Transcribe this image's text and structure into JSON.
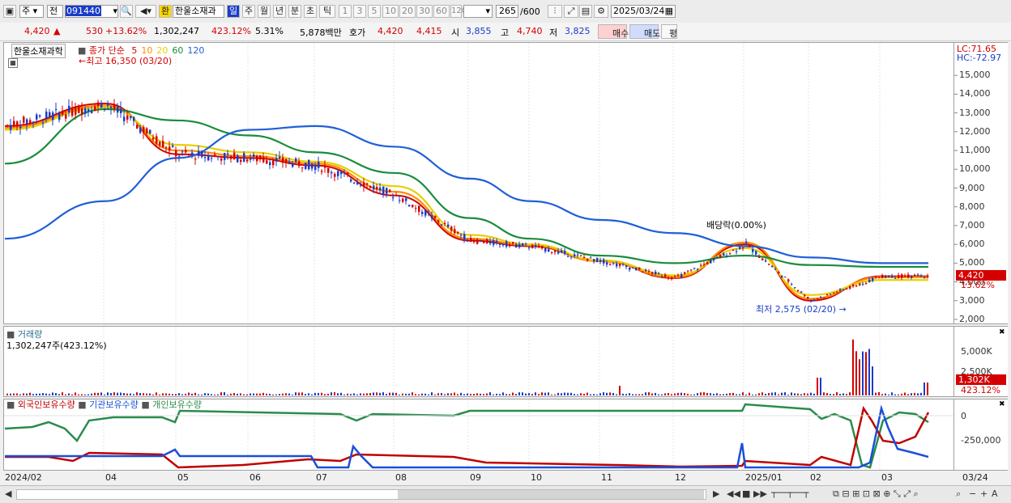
{
  "toolbar": {
    "market": "주",
    "prev": "전",
    "code": "091440",
    "fx": "환",
    "name": "한울소재과",
    "periods": [
      "일",
      "주",
      "월",
      "년",
      "분",
      "초",
      "틱"
    ],
    "nums": [
      "1",
      "3",
      "5",
      "10",
      "20",
      "30",
      "60",
      "120"
    ],
    "count": "265",
    "count_total": "/600",
    "date": "2025/03/24"
  },
  "info": {
    "price": "4,420",
    "arrow": "▲",
    "change": "530",
    "change_pct": "+13.62%",
    "volume": "1,302,247",
    "vol_pct": "423.12%",
    "turnover": "5.31%",
    "amount": "5,878백만",
    "quote_label": "호가",
    "ask": "4,420",
    "bid": "4,415",
    "open_label": "시",
    "open": "3,855",
    "high_label": "고",
    "high": "4,740",
    "low_label": "저",
    "low": "3,825",
    "buy": "매수",
    "sell": "매도",
    "eval": "평"
  },
  "price_panel": {
    "stock_label": "한울소재과학",
    "legend_prefix": "종가 단순",
    "ma": [
      {
        "label": "5",
        "color": "#d40000"
      },
      {
        "label": "10",
        "color": "#ff8c00"
      },
      {
        "label": "20",
        "color": "#e6d000"
      },
      {
        "label": "60",
        "color": "#1a8c3c"
      },
      {
        "label": "120",
        "color": "#1f5fd8"
      }
    ],
    "high_note": "최고 16,350 (03/20)",
    "low_note": "최저 2,575 (02/20)",
    "div_note": "배당락(0.00%)",
    "lc": "LC:71.65",
    "hc": "HC:-72.97",
    "cur_tag": "4,420",
    "pct_tag": "13.62%",
    "y_ticks": [
      "15,000",
      "14,000",
      "13,000",
      "12,000",
      "11,000",
      "10,000",
      "9,000",
      "8,000",
      "7,000",
      "6,000",
      "5,000",
      "4,000",
      "3,000",
      "2,000"
    ]
  },
  "volume_panel": {
    "title": "거래량",
    "value": "1,302,247주(423.12%)",
    "y_ticks": [
      "5,000K",
      "2,500K"
    ],
    "tag1": "1,302K",
    "tag2": "423.12%"
  },
  "holding_panel": {
    "legend": [
      {
        "label": "외국인보유수량",
        "color": "#c00000"
      },
      {
        "label": "기관보유수량",
        "color": "#1a4fd8"
      },
      {
        "label": "개인보유수량",
        "color": "#2a8c4c"
      }
    ],
    "y_ticks": [
      "0",
      "-250,000"
    ]
  },
  "x_axis": [
    "2024/02",
    "04",
    "05",
    "06",
    "07",
    "08",
    "09",
    "10",
    "11",
    "12",
    "2025/01",
    "02",
    "03",
    "03/24"
  ],
  "chart_data": {
    "type": "line",
    "title": "한울소재과학",
    "x": [
      "2024/02",
      "04",
      "05",
      "06",
      "07",
      "08",
      "09",
      "10",
      "11",
      "12",
      "2025/01",
      "02",
      "03"
    ],
    "series": [
      {
        "name": "5",
        "values": [
          12300,
          13500,
          10800,
          10600,
          10200,
          8600,
          6200,
          5900,
          5100,
          4200,
          6000,
          3000,
          4300
        ]
      },
      {
        "name": "10",
        "values": [
          12200,
          13400,
          11000,
          10700,
          10300,
          8800,
          6300,
          5950,
          5100,
          4250,
          6100,
          3100,
          4250
        ]
      },
      {
        "name": "20",
        "values": [
          12100,
          13300,
          11300,
          10900,
          10400,
          9100,
          6500,
          6000,
          5150,
          4350,
          5800,
          3300,
          4100
        ]
      },
      {
        "name": "60",
        "values": [
          10300,
          13200,
          12600,
          11800,
          10900,
          9800,
          7400,
          6300,
          5400,
          5000,
          5400,
          4900,
          4800
        ]
      },
      {
        "name": "120",
        "values": [
          6300,
          8300,
          10600,
          12100,
          12300,
          11200,
          9500,
          8300,
          7300,
          6600,
          5900,
          5300,
          5000
        ]
      }
    ],
    "ylim": [
      2000,
      16000
    ]
  }
}
